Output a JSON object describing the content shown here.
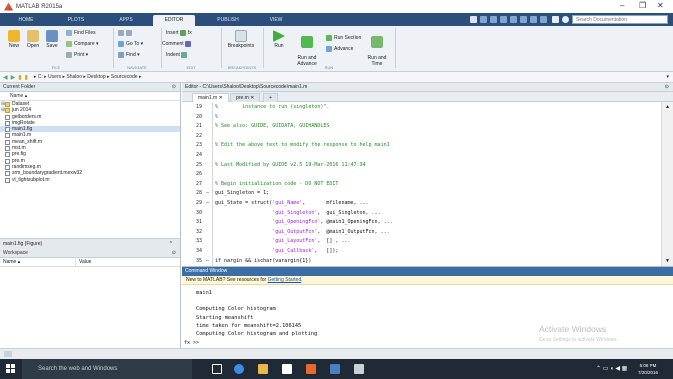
{
  "window": {
    "title": "MATLAB R2015a",
    "minimize": "–",
    "restore": "❐",
    "close": "✕"
  },
  "tabs": [
    "HOME",
    "PLOTS",
    "APPS",
    "EDITOR",
    "PUBLISH",
    "VIEW"
  ],
  "search": {
    "placeholder": "Search Documentation"
  },
  "ribbon": {
    "new": "New",
    "open": "Open",
    "save": "Save",
    "find_files": "Find Files",
    "compare": "Compare ▾",
    "print": "Print ▾",
    "insert": "Insert",
    "fx": "fx",
    "comment": "Comment",
    "indent": "Indent",
    "goto": "Go To ▾",
    "find": "Find ▾",
    "breakpoints": "Breakpoints",
    "run": "Run",
    "run_and_advance": "Run and\nAdvance",
    "run_section": "Run Section",
    "advance": "Advance",
    "run_and_time": "Run and\nTime",
    "sections": [
      "FILE",
      "NAVIGATE",
      "EDIT",
      "BREAKPOINTS",
      "RUN"
    ]
  },
  "address": {
    "path": "▸ C: ▸ Users ▸ Shaloo ▸ Desktop ▸ Sourcecode ▸"
  },
  "current_folder": {
    "title": "Current Folder",
    "column": "Name ▴",
    "items": [
      {
        "name": "Dataset",
        "kind": "folder",
        "prefix": "⊞"
      },
      {
        "name": "jun 2014",
        "kind": "folder",
        "prefix": "⊞"
      },
      {
        "name": "getborders.m",
        "kind": "file"
      },
      {
        "name": "imgRotate",
        "kind": "file"
      },
      {
        "name": "main1.fig",
        "kind": "file",
        "selected": true
      },
      {
        "name": "main1.m",
        "kind": "file"
      },
      {
        "name": "mean_shift.m",
        "kind": "file"
      },
      {
        "name": "mst.m",
        "kind": "file"
      },
      {
        "name": "pre.fig",
        "kind": "file"
      },
      {
        "name": "pre.m",
        "kind": "file"
      },
      {
        "name": "randimseg.m",
        "kind": "file"
      },
      {
        "name": "srm_boundarygradient.mexw32",
        "kind": "file"
      },
      {
        "name": "vl_tightsubplot.m",
        "kind": "file"
      }
    ]
  },
  "details": {
    "label": "main1.fig (Figure)"
  },
  "workspace": {
    "title": "Workspace",
    "col_name": "Name ▴",
    "col_value": "Value"
  },
  "editor": {
    "path": "Editor - C:\\Users\\Shaloo\\Desktop\\Sourcecode\\main1.m",
    "tabs": [
      "main1.m",
      "pre.m",
      "+"
    ],
    "lines": [
      {
        "n": "19",
        "d": "",
        "t": "%        instance to run (singleton)\".",
        "c": true
      },
      {
        "n": "20",
        "d": "",
        "t": "%",
        "c": true
      },
      {
        "n": "21",
        "d": "",
        "t": "% See also: GUIDE, GUIDATA, GUIHANDLES",
        "c": true
      },
      {
        "n": "22",
        "d": "",
        "t": "",
        "c": false
      },
      {
        "n": "23",
        "d": "",
        "t": "% Edit the above text to modify the response to help main1",
        "c": true
      },
      {
        "n": "24",
        "d": "",
        "t": "",
        "c": false
      },
      {
        "n": "25",
        "d": "",
        "t": "% Last Modified by GUIDE v2.5 19-Mar-2016 11:47:34",
        "c": true
      },
      {
        "n": "26",
        "d": "",
        "t": "",
        "c": false
      },
      {
        "n": "27",
        "d": "",
        "t": "% Begin initialization code - DO NOT EDIT",
        "c": true
      },
      {
        "n": "28",
        "d": "–",
        "t": "gui_Singleton = 1;",
        "c": false
      },
      {
        "n": "29",
        "d": "–",
        "t": "gui_State = struct('gui_Name',       mfilename, ...",
        "c": false
      },
      {
        "n": "30",
        "d": "",
        "t": "                   'gui_Singleton',  gui_Singleton, ...",
        "c": false
      },
      {
        "n": "31",
        "d": "",
        "t": "                   'gui_OpeningFcn', @main1_OpeningFcn, ...",
        "c": false
      },
      {
        "n": "32",
        "d": "",
        "t": "                   'gui_OutputFcn',  @main1_OutputFcn, ...",
        "c": false
      },
      {
        "n": "33",
        "d": "",
        "t": "                   'gui_LayoutFcn',  [] , ...",
        "c": false
      },
      {
        "n": "34",
        "d": "",
        "t": "                   'gui_Callback',   []);",
        "c": false
      },
      {
        "n": "35",
        "d": "–",
        "t": "if nargin && ischar(varargin{1})",
        "c": false
      }
    ]
  },
  "command_window": {
    "title": "Command Window",
    "notice": "New to MATLAB? See resources for ",
    "notice_link": "Getting Started",
    "notice_tail": ".",
    "lines": [
      "main1",
      "",
      "Computing Color histogram",
      "Starting meanshift",
      "time taken for meanshift=2.106145",
      "Computing Color histogram and plotting"
    ],
    "prompt": "fx >>"
  },
  "watermark": {
    "title": "Activate Windows",
    "subtitle": "Go to Settings to activate Windows."
  },
  "taskbar": {
    "search": "Search the web and Windows",
    "time": "5:08 PM",
    "date": "7/20/2016"
  }
}
